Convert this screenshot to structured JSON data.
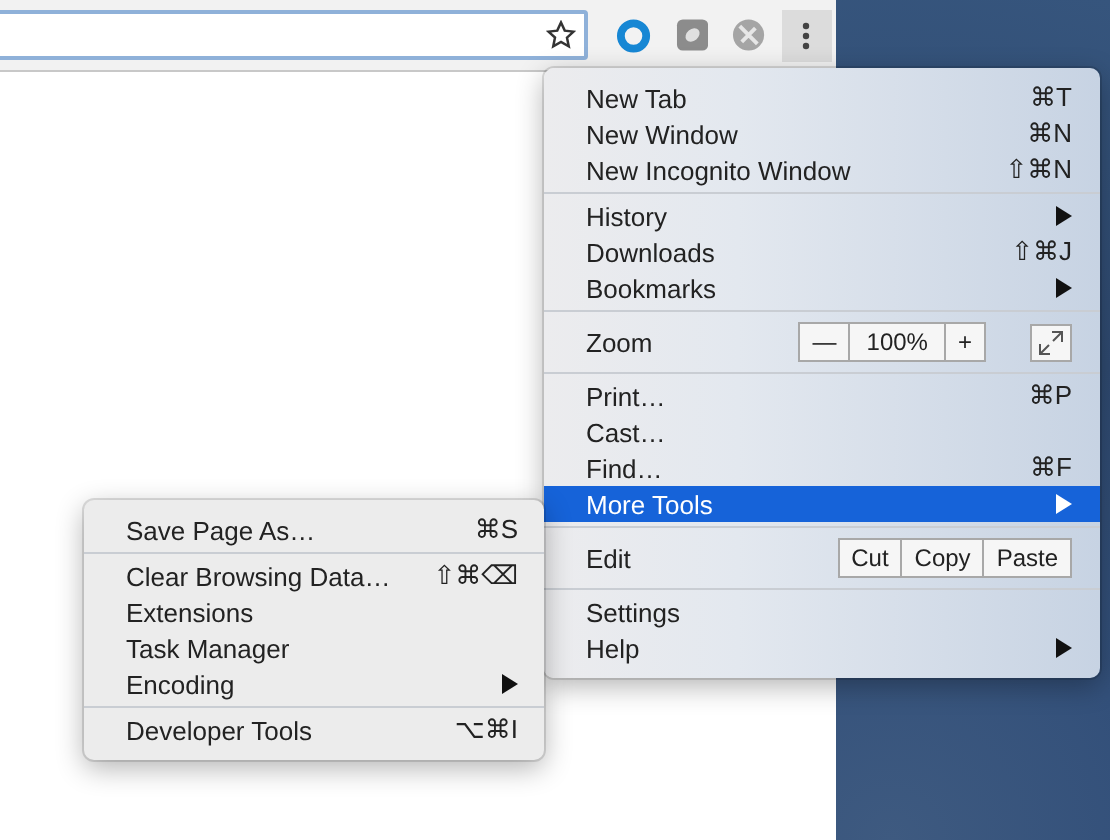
{
  "menu": {
    "groups": [
      {
        "items": [
          {
            "kind": "item",
            "label": "New Tab",
            "shortcut": "⌘T",
            "has_submenu": false,
            "selected": false
          },
          {
            "kind": "item",
            "label": "New Window",
            "shortcut": "⌘N",
            "has_submenu": false,
            "selected": false
          },
          {
            "kind": "item",
            "label": "New Incognito Window",
            "shortcut": "⇧⌘N",
            "has_submenu": false,
            "selected": false
          }
        ]
      },
      {
        "items": [
          {
            "kind": "item",
            "label": "History",
            "has_submenu": true,
            "selected": false
          },
          {
            "kind": "item",
            "label": "Downloads",
            "shortcut": "⇧⌘J",
            "has_submenu": false,
            "selected": false
          },
          {
            "kind": "item",
            "label": "Bookmarks",
            "has_submenu": true,
            "selected": false
          }
        ]
      },
      {
        "items": [
          {
            "kind": "zoom",
            "label": "Zoom",
            "minus": "—",
            "value": "100%",
            "plus": "+"
          }
        ]
      },
      {
        "items": [
          {
            "kind": "item",
            "label": "Print…",
            "shortcut": "⌘P",
            "has_submenu": false,
            "selected": false
          },
          {
            "kind": "item",
            "label": "Cast…",
            "has_submenu": false,
            "selected": false
          },
          {
            "kind": "item",
            "label": "Find…",
            "shortcut": "⌘F",
            "has_submenu": false,
            "selected": false
          },
          {
            "kind": "item",
            "label": "More Tools",
            "has_submenu": true,
            "selected": true
          }
        ]
      },
      {
        "items": [
          {
            "kind": "edit",
            "label": "Edit",
            "buttons": [
              "Cut",
              "Copy",
              "Paste"
            ]
          }
        ]
      },
      {
        "items": [
          {
            "kind": "item",
            "label": "Settings",
            "has_submenu": false,
            "selected": false
          },
          {
            "kind": "item",
            "label": "Help",
            "has_submenu": true,
            "selected": false
          }
        ]
      }
    ]
  },
  "submenu": {
    "groups": [
      {
        "items": [
          {
            "kind": "item",
            "label": "Save Page As…",
            "shortcut": "⌘S",
            "has_submenu": false,
            "selected": false
          }
        ]
      },
      {
        "items": [
          {
            "kind": "item",
            "label": "Clear Browsing Data…",
            "shortcut": "⇧⌘⌫",
            "has_submenu": false,
            "selected": false
          },
          {
            "kind": "item",
            "label": "Extensions",
            "has_submenu": false,
            "selected": false
          },
          {
            "kind": "item",
            "label": "Task Manager",
            "has_submenu": false,
            "selected": false
          },
          {
            "kind": "item",
            "label": "Encoding",
            "has_submenu": true,
            "selected": false
          }
        ]
      },
      {
        "items": [
          {
            "kind": "item",
            "label": "Developer Tools",
            "shortcut": "⌥⌘I",
            "has_submenu": false,
            "selected": false
          }
        ]
      }
    ]
  }
}
